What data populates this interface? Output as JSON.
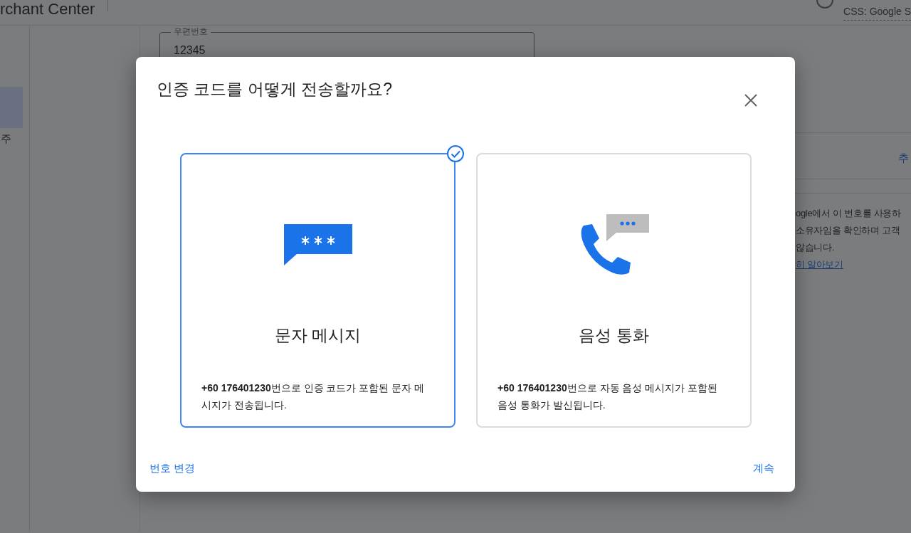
{
  "page": {
    "product": "rchant Center",
    "account": "CSS: Google S",
    "sidebar_text": "주",
    "postal_field": {
      "label": "우편번호",
      "value": "12345"
    },
    "side_link": "추",
    "notice_lines": [
      "ogle에서 이 번호를 사용하",
      "소유자임을 확인하며 고객",
      "않습니다."
    ],
    "notice_link": "히 알아보기"
  },
  "dialog": {
    "title": "인증 코드를 어떻게 전송할까요?",
    "options": [
      {
        "kind": "sms",
        "label": "문자 메시지",
        "description": "**+60 176401230**번으로 인증 코드가 포함된 문자 메시지가 전송됩니다.",
        "selected": true
      },
      {
        "kind": "voice",
        "label": "음성 통화",
        "description": "**+60 176401230**번으로 자동 음성 메시지가 포함된 음성 통화가 발신됩니다.",
        "selected": false
      }
    ],
    "change_number": "번호 변경",
    "continue": "계속"
  }
}
